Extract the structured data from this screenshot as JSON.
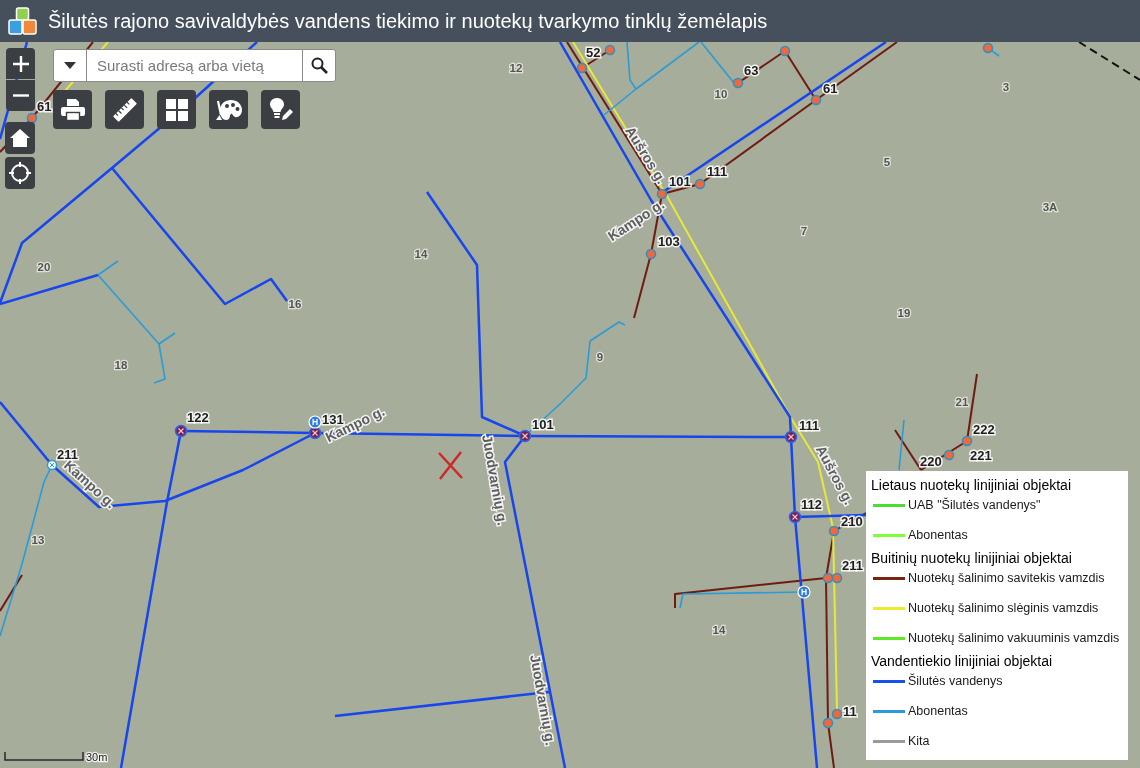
{
  "window": {
    "title": "Šilutės rajono savivaldybės vandens tiekimo ir nuotekų tvarkymo tinklų žemėlapis"
  },
  "search": {
    "placeholder": "Surasti adresą arba vietą"
  },
  "map": {
    "node_labels": [
      "61",
      "52",
      "63",
      "61",
      "101",
      "111",
      "103",
      "122",
      "131",
      "101",
      "111",
      "112",
      "210",
      "211",
      "220",
      "221",
      "222",
      "211",
      "11"
    ],
    "street_labels": [
      "Kampo g.",
      "Kampo g.",
      "Kampo g.",
      "Aušros g.",
      "Aušros g.",
      "Juodvarnių g.",
      "Juodvarnių g."
    ],
    "house_numbers": [
      "12",
      "10",
      "3",
      "5",
      "3A",
      "7",
      "19",
      "14",
      "16",
      "20",
      "18",
      "9",
      "21",
      "14",
      "13"
    ],
    "hydrant_markers": [
      "H",
      "H"
    ],
    "scale": "30m"
  },
  "legend": {
    "sections": [
      {
        "title": "Lietaus nuotekų linijiniai objektai",
        "items": [
          {
            "label": "UAB \"Šilutės vandenys\"",
            "color": "#4ddb3a"
          },
          {
            "label": "Abonentas",
            "color": "#7dff3a"
          }
        ]
      },
      {
        "title": "Buitinių nuotekų linijiniai objektai",
        "items": [
          {
            "label": "Nuotekų šalinimo savitekis vamzdis",
            "color": "#7b2413"
          },
          {
            "label": "Nuotekų šalinimo slėginis vamzdis",
            "color": "#ecec2e"
          },
          {
            "label": "Nuotekų šalinimo vakuuminis vamzdis",
            "color": "#5ee827"
          }
        ]
      },
      {
        "title": "Vandentiekio linijiniai objektai",
        "items": [
          {
            "label": "Šilutės vandenys",
            "color": "#1550ef"
          },
          {
            "label": "Abonentas",
            "color": "#2a9bd9"
          },
          {
            "label": "Kita",
            "color": "#9a9a9a"
          }
        ]
      }
    ]
  }
}
